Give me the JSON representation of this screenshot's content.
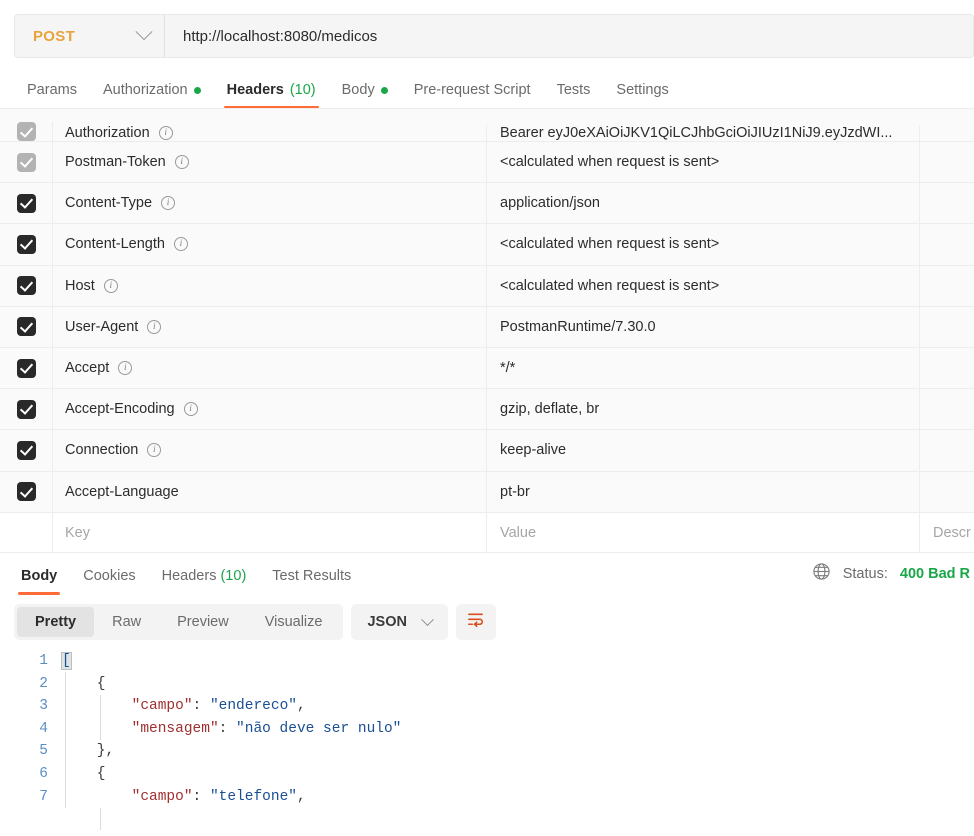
{
  "request": {
    "method": "POST",
    "url": "http://localhost:8080/medicos",
    "method_icon": "chevron-down-icon",
    "tabs": [
      {
        "label": "Params",
        "active": false,
        "dot": false,
        "count": ""
      },
      {
        "label": "Authorization",
        "active": false,
        "dot": true,
        "count": ""
      },
      {
        "label": "Headers",
        "active": true,
        "dot": false,
        "count": "(10)"
      },
      {
        "label": "Body",
        "active": false,
        "dot": true,
        "count": ""
      },
      {
        "label": "Pre-request Script",
        "active": false,
        "dot": false,
        "count": ""
      },
      {
        "label": "Tests",
        "active": false,
        "dot": false,
        "count": ""
      },
      {
        "label": "Settings",
        "active": false,
        "dot": false,
        "count": ""
      }
    ]
  },
  "headers_table": {
    "columns": [
      "Key",
      "Value",
      "Description"
    ],
    "placeholder_key": "Key",
    "placeholder_value": "Value",
    "placeholder_description": "Descr",
    "rows": [
      {
        "checked": true,
        "dim": true,
        "info": true,
        "key": "Authorization",
        "value": "Bearer eyJ0eXAiOiJKV1QiLCJhbGciOiJIUzI1NiJ9.eyJzdWI...",
        "description": ""
      },
      {
        "checked": true,
        "dim": true,
        "info": true,
        "key": "Postman-Token",
        "value": "<calculated when request is sent>",
        "description": ""
      },
      {
        "checked": true,
        "dim": false,
        "info": true,
        "key": "Content-Type",
        "value": "application/json",
        "description": ""
      },
      {
        "checked": true,
        "dim": false,
        "info": true,
        "key": "Content-Length",
        "value": "<calculated when request is sent>",
        "description": ""
      },
      {
        "checked": true,
        "dim": false,
        "info": true,
        "key": "Host",
        "value": "<calculated when request is sent>",
        "description": ""
      },
      {
        "checked": true,
        "dim": false,
        "info": true,
        "key": "User-Agent",
        "value": "PostmanRuntime/7.30.0",
        "description": ""
      },
      {
        "checked": true,
        "dim": false,
        "info": true,
        "key": "Accept",
        "value": "*/*",
        "description": ""
      },
      {
        "checked": true,
        "dim": false,
        "info": true,
        "key": "Accept-Encoding",
        "value": "gzip, deflate, br",
        "description": ""
      },
      {
        "checked": true,
        "dim": false,
        "info": true,
        "key": "Connection",
        "value": "keep-alive",
        "description": ""
      },
      {
        "checked": true,
        "dim": false,
        "info": false,
        "key": "Accept-Language",
        "value": "pt-br",
        "description": ""
      }
    ]
  },
  "response": {
    "tabs": [
      {
        "label": "Body",
        "active": true,
        "count": ""
      },
      {
        "label": "Cookies",
        "active": false,
        "count": ""
      },
      {
        "label": "Headers",
        "active": false,
        "count": "(10)"
      },
      {
        "label": "Test Results",
        "active": false,
        "count": ""
      }
    ],
    "globe_icon": "globe-icon",
    "status_label": "Status:",
    "status_value": "400 Bad R",
    "status_color": "#1aa74a",
    "format_tabs": [
      {
        "label": "Pretty",
        "active": true
      },
      {
        "label": "Raw",
        "active": false
      },
      {
        "label": "Preview",
        "active": false
      },
      {
        "label": "Visualize",
        "active": false
      }
    ],
    "language_select": "JSON",
    "language_select_icon": "chevron-down-icon",
    "wrap_icon": "text-wrap-icon",
    "wrap_icon_color": "#d94f1e",
    "line_numbers": [
      "1",
      "2",
      "3",
      "4",
      "5",
      "6",
      "7"
    ],
    "body_lines": [
      {
        "n": "1",
        "segs": [
          {
            "t": "[",
            "c": "brk-hi"
          }
        ]
      },
      {
        "n": "2",
        "segs": [
          {
            "t": "    {",
            "c": "punct"
          }
        ]
      },
      {
        "n": "3",
        "segs": [
          {
            "t": "        ",
            "c": "punct"
          },
          {
            "t": "\"campo\"",
            "c": "k-str"
          },
          {
            "t": ": ",
            "c": "punct"
          },
          {
            "t": "\"endereco\"",
            "c": "v-str"
          },
          {
            "t": ",",
            "c": "punct"
          }
        ]
      },
      {
        "n": "4",
        "segs": [
          {
            "t": "        ",
            "c": "punct"
          },
          {
            "t": "\"mensagem\"",
            "c": "k-str"
          },
          {
            "t": ": ",
            "c": "punct"
          },
          {
            "t": "\"não deve ser nulo\"",
            "c": "v-str"
          }
        ]
      },
      {
        "n": "5",
        "segs": [
          {
            "t": "    },",
            "c": "punct"
          }
        ]
      },
      {
        "n": "6",
        "segs": [
          {
            "t": "    {",
            "c": "punct"
          }
        ]
      },
      {
        "n": "7",
        "segs": [
          {
            "t": "        ",
            "c": "punct"
          },
          {
            "t": "\"campo\"",
            "c": "k-str"
          },
          {
            "t": ": ",
            "c": "punct"
          },
          {
            "t": "\"telefone\"",
            "c": "v-str"
          },
          {
            "t": ",",
            "c": "punct"
          }
        ]
      }
    ]
  },
  "theme": {
    "accent": "#ff6c37",
    "method_color": "#e8a33d",
    "success": "#1aa74a",
    "json_key": "#a03030",
    "json_value": "#1a4f94"
  }
}
